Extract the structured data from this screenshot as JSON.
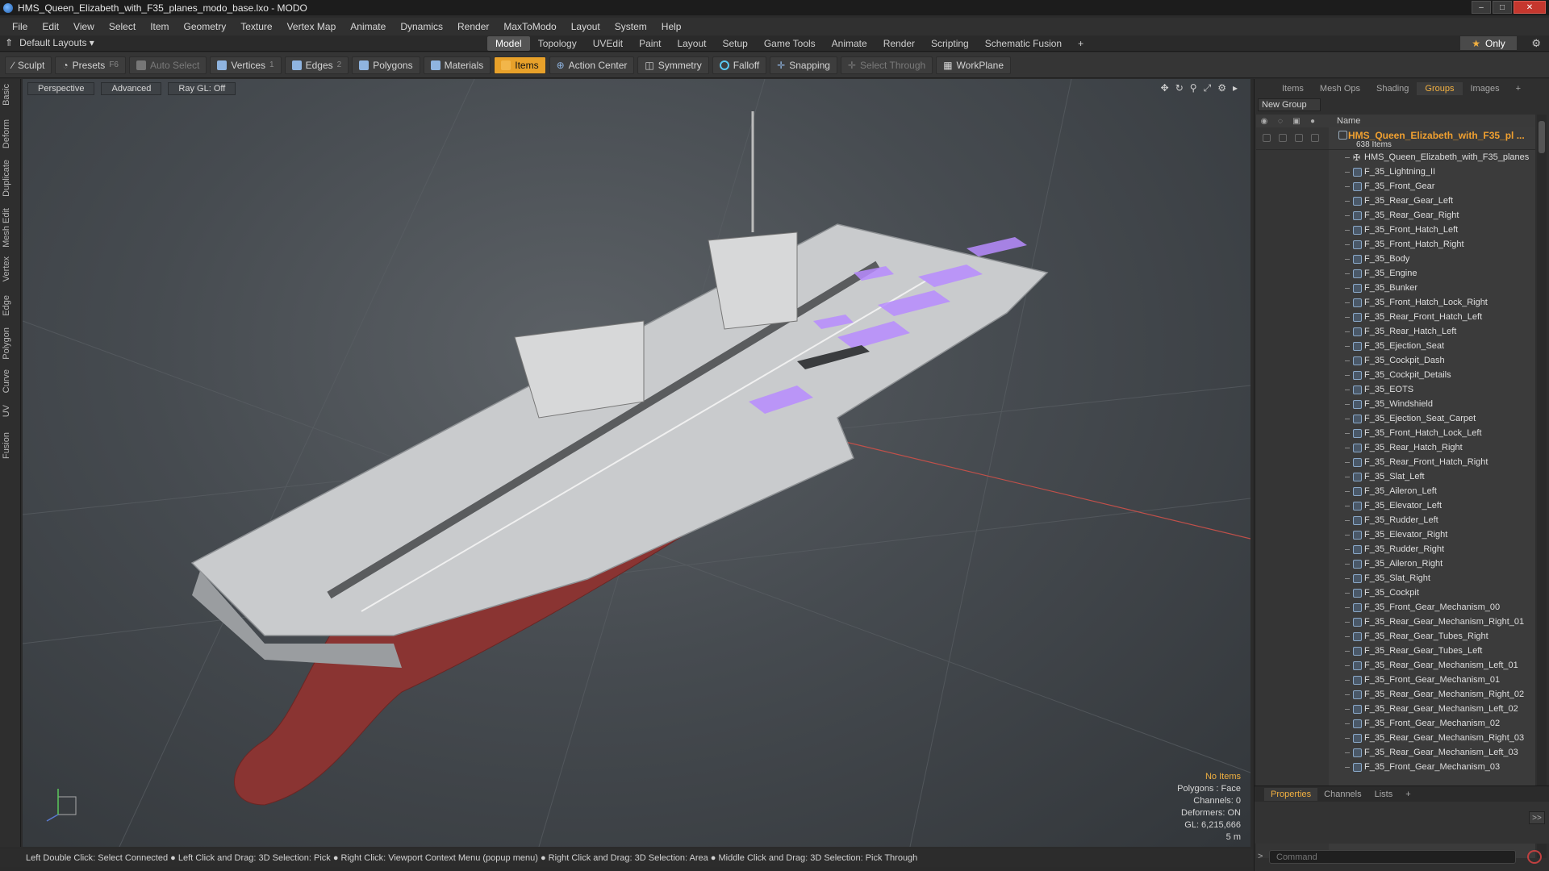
{
  "window": {
    "title": "HMS_Queen_Elizabeth_with_F35_planes_modo_base.lxo - MODO",
    "controls": [
      "–",
      "□",
      "✕"
    ]
  },
  "menu": [
    "File",
    "Edit",
    "View",
    "Select",
    "Item",
    "Geometry",
    "Texture",
    "Vertex Map",
    "Animate",
    "Dynamics",
    "Render",
    "MaxToModo",
    "Layout",
    "System",
    "Help"
  ],
  "layouts": {
    "label": "Default Layouts ▾",
    "tabs": [
      "Model",
      "Topology",
      "UVEdit",
      "Paint",
      "Layout",
      "Setup",
      "Game Tools",
      "Animate",
      "Render",
      "Scripting",
      "Schematic Fusion"
    ],
    "active_tab": "Model",
    "add": "+",
    "only_label": "Only"
  },
  "toolbar": {
    "sculpt": "Sculpt",
    "presets": "Presets",
    "presets_hotkey": "F6",
    "auto_select": "Auto Select",
    "vertices": "Vertices",
    "vertices_count": "1",
    "edges": "Edges",
    "edges_count": "2",
    "polygons": "Polygons",
    "materials": "Materials",
    "items": "Items",
    "action_center": "Action Center",
    "symmetry": "Symmetry",
    "falloff": "Falloff",
    "snapping": "Snapping",
    "select_through": "Select Through",
    "workplane": "WorkPlane"
  },
  "left_tabs": [
    "Basic",
    "Deform",
    "Duplicate",
    "Mesh Edit",
    "Vertex",
    "Edge",
    "Polygon",
    "Curve",
    "UV",
    "Fusion"
  ],
  "viewport": {
    "view": "Perspective",
    "mode": "Advanced",
    "raygl": "Ray GL: Off",
    "info": {
      "items": "No Items",
      "polygons": "Polygons : Face",
      "channels": "Channels: 0",
      "deformers": "Deformers: ON",
      "gl": "GL: 6,215,666",
      "scale": "5 m"
    }
  },
  "status": "Left Double Click: Select Connected ● Left Click and Drag: 3D Selection: Pick ● Right Click: Viewport Context Menu (popup menu) ● Right Click and Drag: 3D Selection: Area ● Middle Click and Drag: 3D Selection: Pick Through",
  "panel": {
    "tabs": [
      "Items",
      "Mesh Ops",
      "Shading",
      "Groups",
      "Images",
      "+"
    ],
    "active_tab": "Groups",
    "new_group": "New Group",
    "column_name": "Name",
    "root": {
      "name": "HMS_Queen_Elizabeth_with_F35_pl ...",
      "count": "638 Items"
    },
    "locator": "HMS_Queen_Elizabeth_with_F35_planes",
    "items": [
      "F_35_Lightning_II",
      "F_35_Front_Gear",
      "F_35_Rear_Gear_Left",
      "F_35_Rear_Gear_Right",
      "F_35_Front_Hatch_Left",
      "F_35_Front_Hatch_Right",
      "F_35_Body",
      "F_35_Engine",
      "F_35_Bunker",
      "F_35_Front_Hatch_Lock_Right",
      "F_35_Rear_Front_Hatch_Left",
      "F_35_Rear_Hatch_Left",
      "F_35_Ejection_Seat",
      "F_35_Cockpit_Dash",
      "F_35_Cockpit_Details",
      "F_35_EOTS",
      "F_35_Windshield",
      "F_35_Ejection_Seat_Carpet",
      "F_35_Front_Hatch_Lock_Left",
      "F_35_Rear_Hatch_Right",
      "F_35_Rear_Front_Hatch_Right",
      "F_35_Slat_Left",
      "F_35_Aileron_Left",
      "F_35_Elevator_Left",
      "F_35_Rudder_Left",
      "F_35_Elevator_Right",
      "F_35_Rudder_Right",
      "F_35_Aileron_Right",
      "F_35_Slat_Right",
      "F_35_Cockpit",
      "F_35_Front_Gear_Mechanism_00",
      "F_35_Rear_Gear_Mechanism_Right_01",
      "F_35_Rear_Gear_Tubes_Right",
      "F_35_Rear_Gear_Tubes_Left",
      "F_35_Rear_Gear_Mechanism_Left_01",
      "F_35_Front_Gear_Mechanism_01",
      "F_35_Rear_Gear_Mechanism_Right_02",
      "F_35_Rear_Gear_Mechanism_Left_02",
      "F_35_Front_Gear_Mechanism_02",
      "F_35_Rear_Gear_Mechanism_Right_03",
      "F_35_Rear_Gear_Mechanism_Left_03",
      "F_35_Front_Gear_Mechanism_03"
    ],
    "bottom_tabs": [
      "Properties",
      "Channels",
      "Lists",
      "+"
    ],
    "active_bottom_tab": "Properties",
    "expander": ">>",
    "command_placeholder": "Command"
  },
  "colors": {
    "accent": "#e8a12a",
    "selection_highlight": "#b88cff",
    "hull_red": "#8a3432"
  }
}
